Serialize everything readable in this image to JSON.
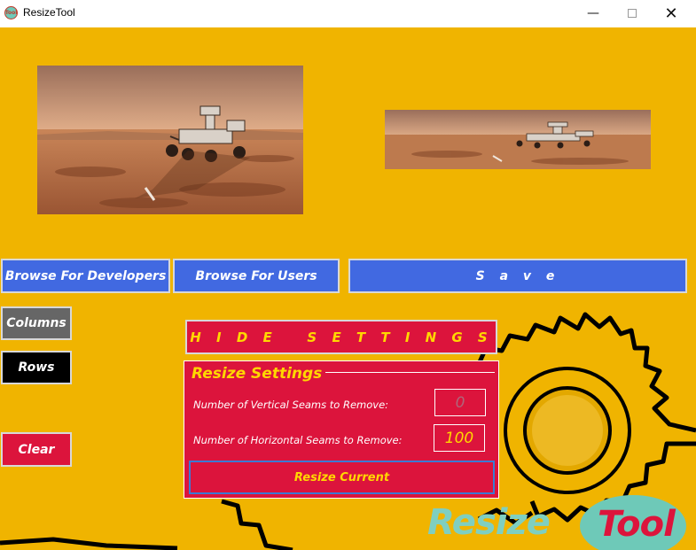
{
  "window": {
    "title": "ResizeTool",
    "icon_text": "Tool",
    "minimize_glyph": "—",
    "close_glyph": "✕"
  },
  "images": {
    "original": "mars-rover-photo-original",
    "resized": "mars-rover-photo-resized"
  },
  "toolbar": {
    "browse_developers": "Browse For Developers",
    "browse_users": "Browse For Users",
    "save": "S a v e"
  },
  "side": {
    "columns": "Columns",
    "rows": "Rows",
    "clear": "Clear"
  },
  "settings": {
    "toggle_label": "H I D E   S E T T I N G S",
    "title": "Resize Settings",
    "vertical_label": "Number of Vertical Seams to Remove:",
    "vertical_value": "0",
    "horizontal_label": "Number of Horizontal Seams to Remove:",
    "horizontal_value": "100",
    "resize_button": "Resize Current"
  },
  "logo": {
    "part1": "Resize",
    "part2": "Tool"
  },
  "colors": {
    "background": "#f0b400",
    "blue_button": "#4169e1",
    "crimson": "#dc143c",
    "gold_text": "#ffd700",
    "columns_button": "#666666",
    "rows_button": "#000000"
  }
}
